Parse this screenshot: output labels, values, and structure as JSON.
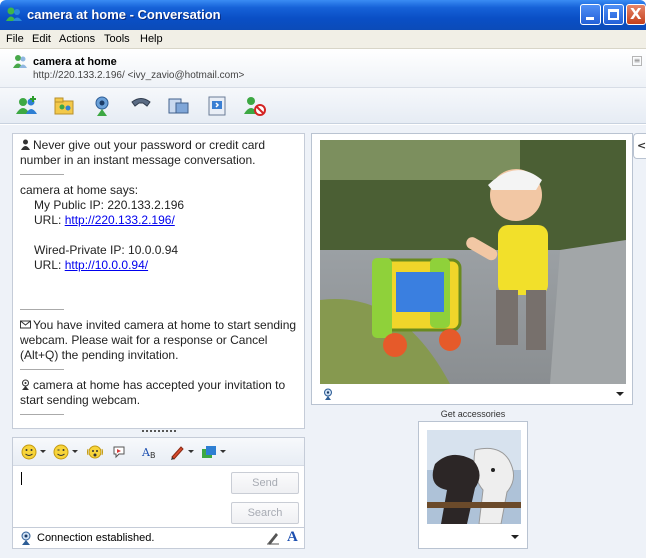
{
  "window": {
    "title": "camera at home - Conversation",
    "minimize_label": "_",
    "maximize_label": "□",
    "close_label": "X"
  },
  "menu": {
    "items": [
      "File",
      "Edit",
      "Actions",
      "Tools",
      "Help"
    ]
  },
  "contact": {
    "name": "camera at home",
    "address": "http://220.133.2.196/ <ivy_zavio@hotmail.com>",
    "icon": "buddy-icon"
  },
  "toolbar": {
    "buttons": [
      {
        "name": "invite-contact",
        "icon": "add-contact-icon"
      },
      {
        "name": "send-files",
        "icon": "send-files-icon"
      },
      {
        "name": "webcam",
        "icon": "webcam-icon"
      },
      {
        "name": "call",
        "icon": "phone-icon"
      },
      {
        "name": "activities",
        "icon": "activities-icon"
      },
      {
        "name": "games",
        "icon": "games-icon"
      },
      {
        "name": "block",
        "icon": "block-contact-icon"
      }
    ]
  },
  "history": {
    "warning": "Never give out your password or credit card number in an instant message conversation.",
    "says_header": "camera at home says:",
    "public_ip_line": "My Public IP: 220.133.2.196",
    "public_url_label": "URL: ",
    "public_url": "http://220.133.2.196/",
    "private_ip_line": "Wired-Private IP: 10.0.0.94",
    "private_url_label": "URL: ",
    "private_url": "http://10.0.0.94/",
    "invite_msg": "You have invited camera at home to start sending webcam. Please wait for a response or Cancel (Alt+Q) the pending invitation.",
    "accepted_msg": "camera at home has accepted your invitation to start sending webcam."
  },
  "input": {
    "value": "",
    "send_label": "Send",
    "search_label": "Search"
  },
  "emote_bar": {
    "items": [
      "emoticon-icon",
      "wink-icon",
      "nudge-icon",
      "voice-clip-icon",
      "font-icon",
      "handwriting-icon",
      "background-icon"
    ]
  },
  "status": {
    "text": "Connection established.",
    "font_label": "A"
  },
  "side": {
    "accessories_label": "Get accessories",
    "collapse_glyph": "<"
  },
  "colors": {
    "titlebar": "#0a4fc6",
    "link": "#0000ee",
    "panel_border": "#c5ccd8"
  }
}
